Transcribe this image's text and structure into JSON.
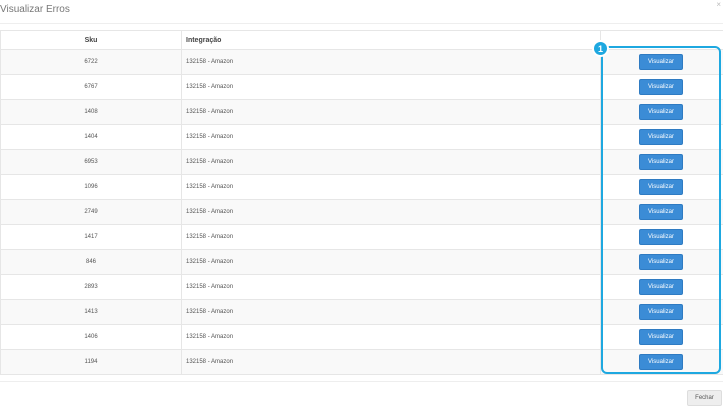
{
  "modal": {
    "title": "Visualizar Erros",
    "close_icon": "×"
  },
  "table": {
    "headers": {
      "sku": "Sku",
      "integracao": "Integração"
    },
    "rows": [
      {
        "sku": "6722",
        "integracao": "132158 - Amazon",
        "action": "Visualizar"
      },
      {
        "sku": "6767",
        "integracao": "132158 - Amazon",
        "action": "Visualizar"
      },
      {
        "sku": "1408",
        "integracao": "132158 - Amazon",
        "action": "Visualizar"
      },
      {
        "sku": "1404",
        "integracao": "132158 - Amazon",
        "action": "Visualizar"
      },
      {
        "sku": "6953",
        "integracao": "132158 - Amazon",
        "action": "Visualizar"
      },
      {
        "sku": "1096",
        "integracao": "132158 - Amazon",
        "action": "Visualizar"
      },
      {
        "sku": "2749",
        "integracao": "132158 - Amazon",
        "action": "Visualizar"
      },
      {
        "sku": "1417",
        "integracao": "132158 - Amazon",
        "action": "Visualizar"
      },
      {
        "sku": "846",
        "integracao": "132158 - Amazon",
        "action": "Visualizar"
      },
      {
        "sku": "2893",
        "integracao": "132158 - Amazon",
        "action": "Visualizar"
      },
      {
        "sku": "1413",
        "integracao": "132158 - Amazon",
        "action": "Visualizar"
      },
      {
        "sku": "1406",
        "integracao": "132158 - Amazon",
        "action": "Visualizar"
      },
      {
        "sku": "1194",
        "integracao": "132158 - Amazon",
        "action": "Visualizar"
      }
    ]
  },
  "annotation": {
    "badge": "1",
    "color": "#1ea8e0"
  },
  "footer": {
    "close_label": "Fechar"
  },
  "colors": {
    "button_primary": "#3b8cd6",
    "button_default": "#eeeeee"
  }
}
